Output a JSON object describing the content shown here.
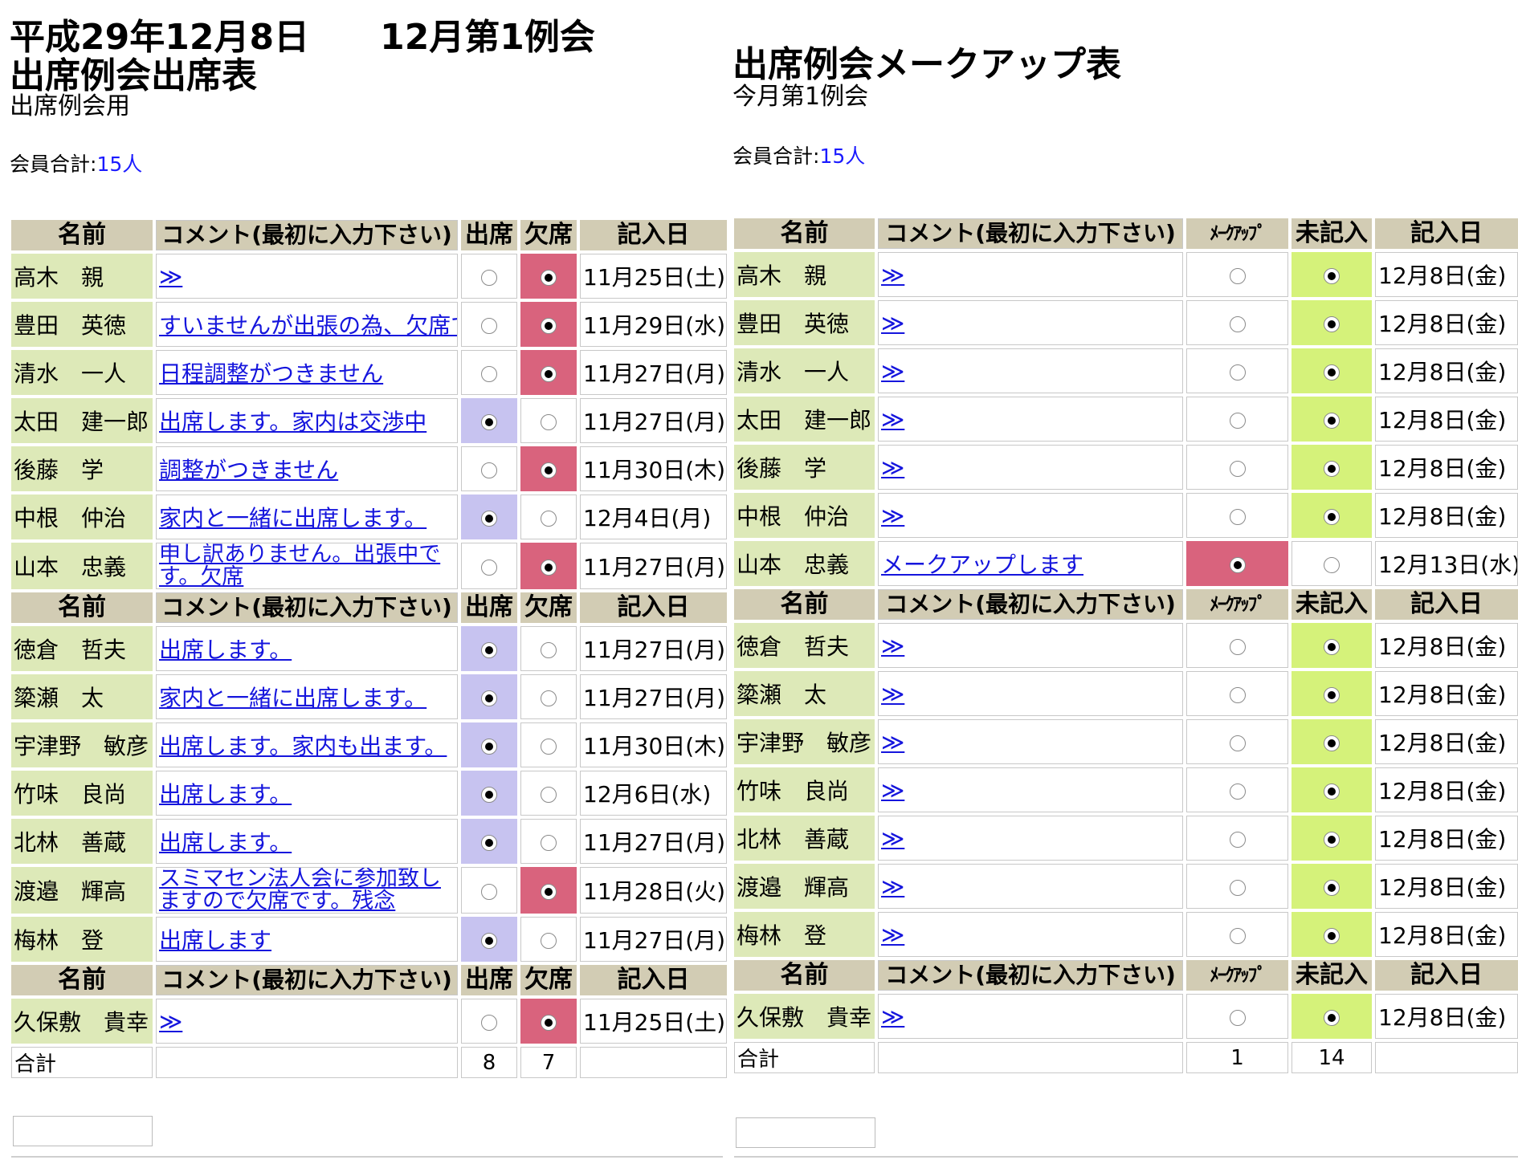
{
  "left": {
    "date_line": "平成29年12月8日　　12月第1例会",
    "title": "出席例会出席表",
    "subtitle": "出席例会用",
    "member_label": "会員合計:",
    "member_count": "15人",
    "header": {
      "name": "名前",
      "comment": "コメント(最初に入力下さい)",
      "col1": "出席",
      "col2": "欠席",
      "date": "記入日"
    },
    "groups": [
      [
        {
          "name": "高木　親",
          "comment": "≫",
          "choice": 2,
          "date": "11月25日(土)"
        },
        {
          "name": "豊田　英徳",
          "comment": "すいませんが出張の為、欠席です。",
          "choice": 2,
          "date": "11月29日(水)"
        },
        {
          "name": "清水　一人",
          "comment": "日程調整がつきません",
          "choice": 2,
          "date": "11月27日(月)"
        },
        {
          "name": "太田　建一郎",
          "comment": "出席します。家内は交渉中",
          "choice": 1,
          "date": "11月27日(月)"
        },
        {
          "name": "後藤　学",
          "comment": "調整がつきません",
          "choice": 2,
          "date": "11月30日(木)"
        },
        {
          "name": "中根　仲治",
          "comment": "家内と一緒に出席します。",
          "choice": 1,
          "date": "12月4日(月)"
        },
        {
          "name": "山本　忠義",
          "comment": "申し訳ありません。出張中です。欠席",
          "choice": 2,
          "date": "11月27日(月)"
        }
      ],
      [
        {
          "name": "徳倉　哲夫",
          "comment": "出席します。",
          "choice": 1,
          "date": "11月27日(月)"
        },
        {
          "name": "簗瀬　太",
          "comment": "家内と一緒に出席します。",
          "choice": 1,
          "date": "11月27日(月)"
        },
        {
          "name": "宇津野　敏彦",
          "comment": "出席します。家内も出ます。",
          "choice": 1,
          "date": "11月30日(木)"
        },
        {
          "name": "竹味　良尚",
          "comment": "出席します。",
          "choice": 1,
          "date": "12月6日(水)"
        },
        {
          "name": "北林　善蔵",
          "comment": "出席します。",
          "choice": 1,
          "date": "11月27日(月)"
        },
        {
          "name": "渡邉　輝高",
          "comment": "スミマセン法人会に参加致しますので欠席です。残念",
          "choice": 2,
          "date": "11月28日(火)"
        },
        {
          "name": "梅林　登",
          "comment": "出席します",
          "choice": 1,
          "date": "11月27日(月)"
        }
      ],
      [
        {
          "name": "久保敷　貴幸",
          "comment": "≫",
          "choice": 2,
          "date": "11月25日(土)"
        }
      ]
    ],
    "total_label": "合計",
    "total_col1": "8",
    "total_col2": "7"
  },
  "right": {
    "title": "出席例会メークアップ表",
    "subtitle": "今月第1例会",
    "member_label": "会員合計:",
    "member_count": "15人",
    "header": {
      "name": "名前",
      "comment": "コメント(最初に入力下さい)",
      "col1": "ﾒｰｸｱｯﾌﾟ",
      "col2": "未記入",
      "date": "記入日"
    },
    "groups": [
      [
        {
          "name": "高木　親",
          "comment": "≫",
          "choice": 2,
          "date": "12月8日(金)"
        },
        {
          "name": "豊田　英徳",
          "comment": "≫",
          "choice": 2,
          "date": "12月8日(金)"
        },
        {
          "name": "清水　一人",
          "comment": "≫",
          "choice": 2,
          "date": "12月8日(金)"
        },
        {
          "name": "太田　建一郎",
          "comment": "≫",
          "choice": 2,
          "date": "12月8日(金)"
        },
        {
          "name": "後藤　学",
          "comment": "≫",
          "choice": 2,
          "date": "12月8日(金)"
        },
        {
          "name": "中根　仲治",
          "comment": "≫",
          "choice": 2,
          "date": "12月8日(金)"
        },
        {
          "name": "山本　忠義",
          "comment": "メークアップします",
          "choice": 1,
          "date": "12月13日(水)"
        }
      ],
      [
        {
          "name": "徳倉　哲夫",
          "comment": "≫",
          "choice": 2,
          "date": "12月8日(金)"
        },
        {
          "name": "簗瀬　太",
          "comment": "≫",
          "choice": 2,
          "date": "12月8日(金)"
        },
        {
          "name": "宇津野　敏彦",
          "comment": "≫",
          "choice": 2,
          "date": "12月8日(金)"
        },
        {
          "name": "竹味　良尚",
          "comment": "≫",
          "choice": 2,
          "date": "12月8日(金)"
        },
        {
          "name": "北林　善蔵",
          "comment": "≫",
          "choice": 2,
          "date": "12月8日(金)"
        },
        {
          "name": "渡邉　輝高",
          "comment": "≫",
          "choice": 2,
          "date": "12月8日(金)"
        },
        {
          "name": "梅林　登",
          "comment": "≫",
          "choice": 2,
          "date": "12月8日(金)"
        }
      ],
      [
        {
          "name": "久保敷　貴幸",
          "comment": "≫",
          "choice": 2,
          "date": "12月8日(金)"
        }
      ]
    ],
    "total_label": "合計",
    "total_col1": "1",
    "total_col2": "14"
  },
  "colors": {
    "attend": "#c7c3f0",
    "absent": "#d9637d",
    "makeup": "#d9637d",
    "unfilled": "#d5f27a",
    "header": "#d2ccb4",
    "name": "#dde9b8",
    "link": "#1515dd"
  }
}
